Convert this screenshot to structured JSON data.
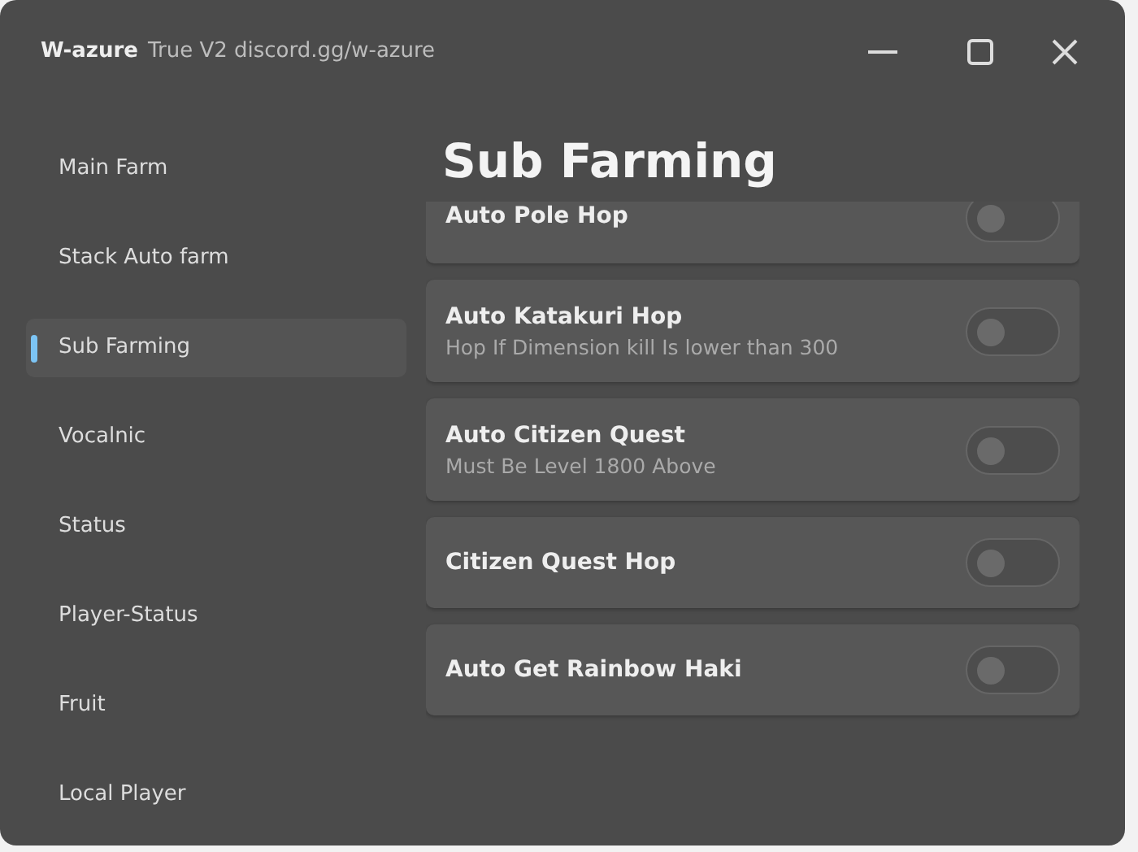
{
  "window": {
    "title": "W-azure",
    "subtitle": "True V2 discord.gg/w-azure"
  },
  "sidebar": {
    "items": [
      {
        "label": "Main Farm",
        "selected": false
      },
      {
        "label": "Stack Auto farm",
        "selected": false
      },
      {
        "label": "Sub Farming",
        "selected": true
      },
      {
        "label": "Vocalnic",
        "selected": false
      },
      {
        "label": "Status",
        "selected": false
      },
      {
        "label": "Player-Status",
        "selected": false
      },
      {
        "label": "Fruit",
        "selected": false
      },
      {
        "label": "Local Player",
        "selected": false
      }
    ]
  },
  "page": {
    "title": "Sub Farming",
    "toggles": [
      {
        "label": "Auto Pole Hop",
        "on": false
      },
      {
        "label": "Auto Katakuri Hop",
        "description": "Hop If Dimension kill Is lower than 300",
        "on": false
      },
      {
        "label": "Auto Citizen Quest",
        "description": "Must Be Level 1800 Above",
        "on": false
      },
      {
        "label": "Citizen Quest Hop",
        "on": false
      },
      {
        "label": "Auto Get Rainbow Haki",
        "on": false
      }
    ]
  }
}
